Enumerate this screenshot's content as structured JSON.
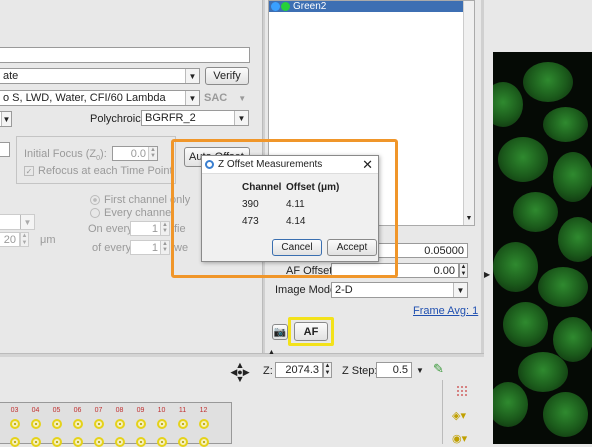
{
  "top_panel": {
    "objective_text": "o S, LWD, Water, CFI/60 Lambda",
    "state_text": "ate",
    "verify_label": "Verify",
    "sac_label": "SAC",
    "polychroic_label": "Polychroic:",
    "polychroic_value": "BGRFR_2"
  },
  "channel_list": {
    "item": "Green2"
  },
  "af_panel": {
    "initial_focus_label": "Initial Focus (Z",
    "initial_focus_sub": "0",
    "initial_focus_suffix": "):",
    "initial_focus_value": "0.0",
    "refocus_label": "Refocus at each Time Point",
    "first_channel_label": "First channel only",
    "every_channel_label": "Every channel",
    "on_every_label": "On every",
    "on_every_value": "1",
    "on_every_unit": "fie",
    "of_every_label": "of every",
    "of_every_value": "1",
    "of_every_unit": "we",
    "left_value": "20",
    "left_unit": "μm",
    "offset_btn_label": "Auto Offset",
    "value_1": "0.05000",
    "af_offset_label": "AF Offset:",
    "af_offset_value": "0.00",
    "image_mode_label": "Image Mode:",
    "image_mode_value": "2-D",
    "frame_avg_label": "Frame Avg: 1",
    "af_button_label": "AF"
  },
  "dialog": {
    "title": "Z Offset Measurements",
    "col_channel": "Channel",
    "col_offset": "Offset (μm)",
    "rows": [
      {
        "channel": "390",
        "offset": "4.11"
      },
      {
        "channel": "473",
        "offset": "4.14"
      }
    ],
    "cancel_label": "Cancel",
    "accept_label": "Accept"
  },
  "z_bar": {
    "z_label": "Z:",
    "z_value": "2074.3",
    "z_step_label": "Z Step:",
    "z_step_value": "0.5"
  },
  "plate": {
    "columns": [
      "03",
      "04",
      "05",
      "06",
      "07",
      "08",
      "09",
      "10",
      "11",
      "12"
    ]
  },
  "colors": {
    "highlight_orange": "#f0962a",
    "highlight_yellow": "#f3e21a",
    "selection_blue": "#3d6fb3"
  }
}
